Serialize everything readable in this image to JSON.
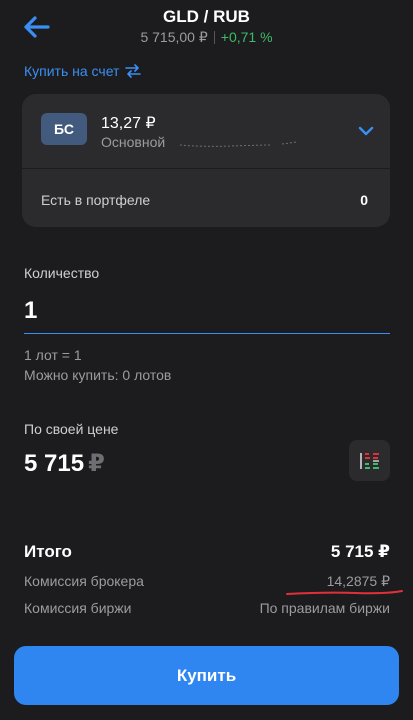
{
  "header": {
    "title": "GLD / RUB",
    "price": "5 715,00 ₽",
    "change": "+0,71 %",
    "back_icon": "arrow-left-icon"
  },
  "account_type": {
    "label": "Купить на счет",
    "icon": "swap-arrows-icon"
  },
  "account": {
    "badge": "БС",
    "balance": "13,27 ₽",
    "name": "Основной",
    "chevron_icon": "chevron-down-icon"
  },
  "portfolio": {
    "label": "Есть в портфеле",
    "value": "0"
  },
  "quantity": {
    "label": "Количество",
    "value": "1",
    "lot_info": "1 лот = 1",
    "can_buy": "Можно купить: 0 лотов"
  },
  "price": {
    "label": "По своей цене",
    "value": "5 715",
    "currency": "₽",
    "orderbook_icon": "order-book-icon"
  },
  "totals": {
    "total_label": "Итого",
    "total_value": "5 715 ₽",
    "broker_fee_label": "Комиссия брокера",
    "broker_fee_value": "14,2875 ₽",
    "exchange_fee_label": "Комиссия биржи",
    "exchange_fee_value": "По правилам биржи"
  },
  "buy_button": {
    "label": "Купить"
  },
  "colors": {
    "background": "#1c1c1e",
    "card": "#2b2b2d",
    "accent": "#2f86f0",
    "positive": "#3dbb68",
    "annotation": "#e0303a"
  }
}
